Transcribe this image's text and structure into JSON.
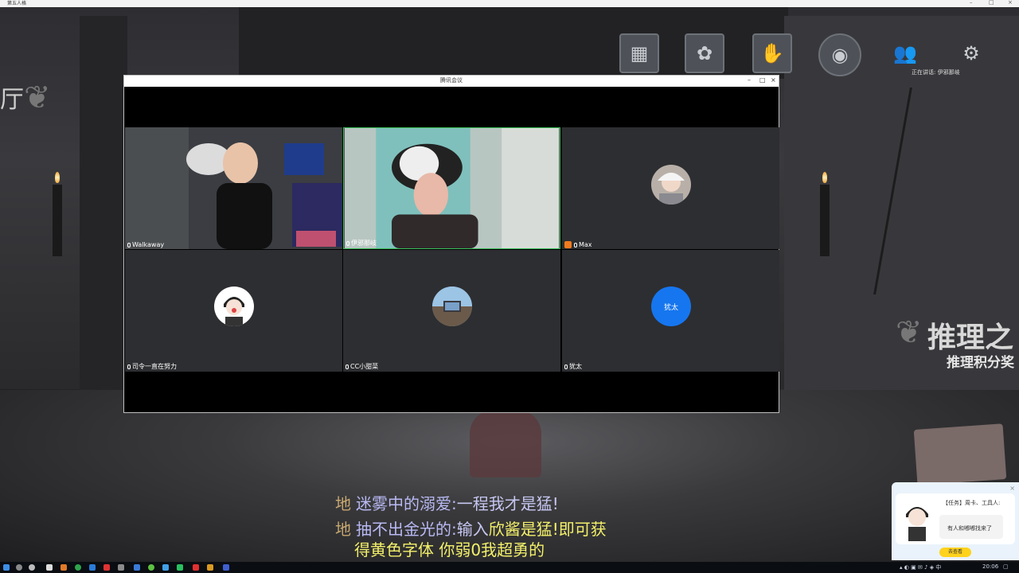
{
  "os_window": {
    "title": "第五人格"
  },
  "meeting": {
    "title": "腾讯会议",
    "participants": [
      {
        "name": "Walkaway",
        "kind": "video"
      },
      {
        "name": "伊邪那岐",
        "kind": "video"
      },
      {
        "name": "Max",
        "kind": "avatar",
        "host": true
      },
      {
        "name": "司令一直在努力",
        "kind": "avatar"
      },
      {
        "name": "CC小甜菜",
        "kind": "avatar"
      },
      {
        "name": "犹太",
        "kind": "initials",
        "initials": "犹太",
        "color": "#1676ef"
      }
    ]
  },
  "game": {
    "left_char": "厅",
    "title_big": "推理之",
    "title_small": "推理积分奖",
    "notice": "正在讲话: 伊邪那岐",
    "icons": [
      "gallery-icon",
      "flower-icon",
      "hands-icon",
      "profile-icon",
      "friends-icon",
      "settings-icon"
    ]
  },
  "danmaku": [
    {
      "tag": "地",
      "name": "迷雾中的溺爱:",
      "msg": "一程我才是猛!",
      "hl": ""
    },
    {
      "tag": "地",
      "name": "抽不出金光的:",
      "msg": "输入",
      "hl": "欣酱是猛!即可获"
    }
  ],
  "danmaku_line3": "得黄色字体   你弱0我超勇的",
  "popup": {
    "title": "【任务】周卡、工具人:",
    "message": "有人和嘟嘟找来了",
    "button": "去查看"
  },
  "taskbar": {
    "time": "20:06"
  }
}
